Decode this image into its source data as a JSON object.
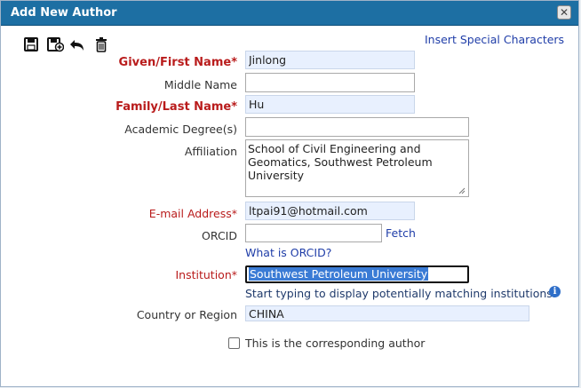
{
  "dialog": {
    "title": "Add New Author",
    "close_icon": "close-icon",
    "insert_special_link": "Insert Special Characters",
    "toolbar_icons": [
      "save-icon",
      "save-add-icon",
      "undo-icon",
      "delete-icon"
    ]
  },
  "form": {
    "given_name": {
      "label": "Given/First Name*",
      "value": "Jinlong"
    },
    "middle_name": {
      "label": "Middle Name",
      "value": ""
    },
    "family_name": {
      "label": "Family/Last Name*",
      "value": "Hu"
    },
    "degree": {
      "label": "Academic Degree(s)",
      "value": ""
    },
    "affiliation": {
      "label": "Affiliation",
      "value": "School of Civil Engineering and Geomatics, Southwest Petroleum University"
    },
    "email": {
      "label": "E-mail Address*",
      "value": "ltpai91@hotmail.com"
    },
    "orcid": {
      "label": "ORCID",
      "value": "",
      "fetch_link": "Fetch",
      "what_link": "What is ORCID?"
    },
    "institution": {
      "label": "Institution*",
      "value": "Southwest Petroleum University",
      "helper": "Start typing to display potentially matching institutions."
    },
    "country": {
      "label": "Country or Region",
      "value": "CHINA"
    },
    "corresponding": {
      "label": "This is the corresponding author",
      "checked": false
    }
  }
}
